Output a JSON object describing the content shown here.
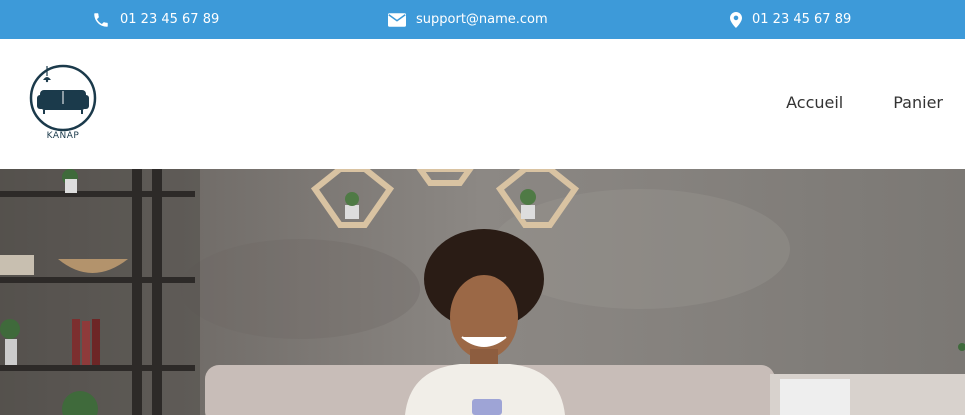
{
  "topbar": {
    "phone": "01 23 45 67 89",
    "email": "support@name.com",
    "address": "01 23 45 67 89",
    "icons": [
      "phone-icon",
      "envelope-icon",
      "map-pin-icon"
    ]
  },
  "brand": {
    "name": "KANAP"
  },
  "nav": {
    "home": "Accueil",
    "cart": "Panier"
  },
  "colors": {
    "topbar": "#3d9ad9",
    "logo": "#1b3a4b"
  },
  "hero": {
    "image": "woman-on-sofa-with-phone"
  }
}
